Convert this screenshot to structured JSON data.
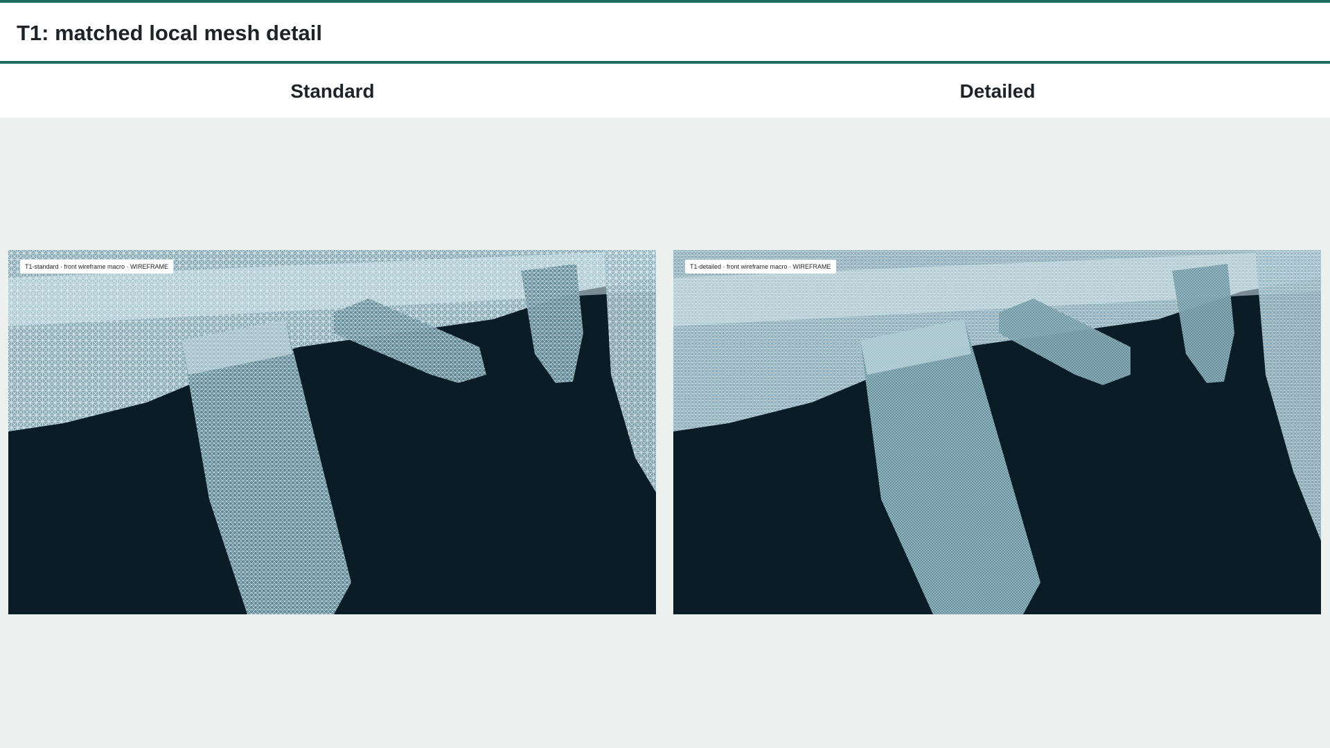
{
  "page": {
    "title": "T1: matched local mesh detail"
  },
  "panels": [
    {
      "heading": "Standard",
      "viewport_label": "T1-standard · front wireframe macro · WIREFRAME"
    },
    {
      "heading": "Detailed",
      "viewport_label": "T1-detailed · front wireframe macro · WIREFRAME"
    }
  ],
  "colors": {
    "accent": "#1d6b61",
    "stage_background": "#ecf1ef",
    "viewport_background": "#0a1c26",
    "mesh": "#cfe3ea"
  }
}
